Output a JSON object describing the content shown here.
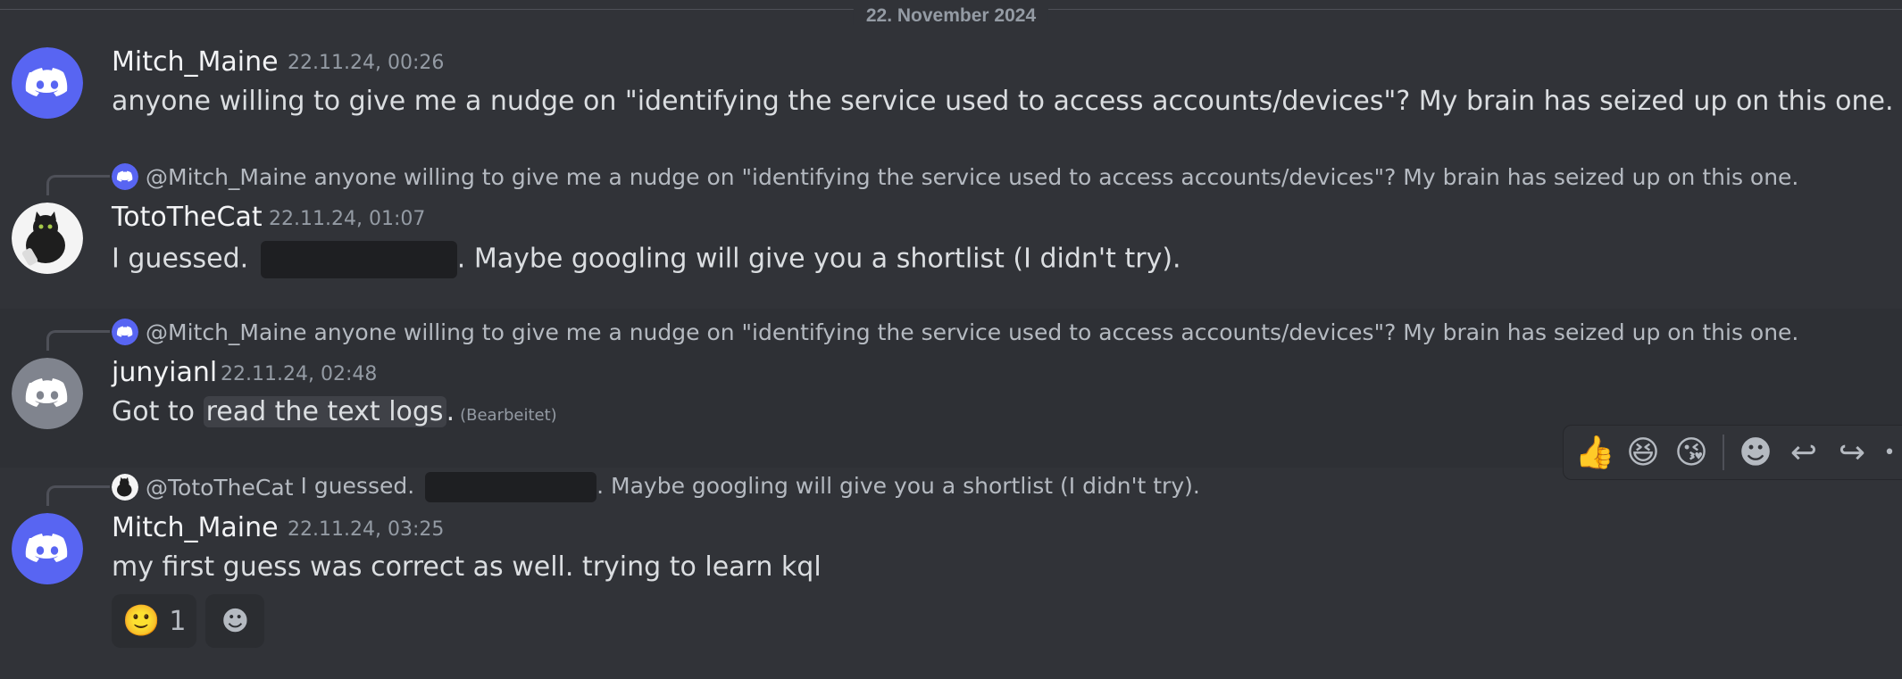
{
  "date_divider": "22. November 2024",
  "messages": [
    {
      "username": "Mitch_Maine",
      "timestamp": "22.11.24, 00:26",
      "text": "anyone willing to give me a nudge on \"identifying the service used to access accounts/devices\"? My brain has seized up on this one."
    },
    {
      "reply_to_name": "@Mitch_Maine",
      "reply_to_text": "anyone willing to give me a nudge on \"identifying the service used to access accounts/devices\"? My brain has seized up on this one.",
      "username": "TotoTheCat",
      "timestamp": "22.11.24, 01:07",
      "text_before": "I guessed.",
      "text_after": ". Maybe googling will give you a shortlist (I didn't try)."
    },
    {
      "reply_to_name": "@Mitch_Maine",
      "reply_to_text": "anyone willing to give me a nudge on \"identifying the service used to access accounts/devices\"? My brain has seized up on this one.",
      "username": "junyianl",
      "timestamp": "22.11.24, 02:48",
      "text_before": "Got to",
      "text_highlight": "read the text logs",
      "text_after": ".",
      "edited": "(Bearbeitet)"
    },
    {
      "reply_to_name": "@TotoTheCat",
      "reply_to_text_before": "I guessed.",
      "reply_to_text_after": ". Maybe googling will give you a shortlist (I didn't try).",
      "username": "Mitch_Maine",
      "timestamp": "22.11.24, 03:25",
      "text": "my first guess was correct as well. trying to learn kql",
      "reactions": [
        {
          "emoji": "🙂",
          "count": "1"
        }
      ],
      "add_reaction_icon": "☻"
    }
  ],
  "toolbar": {
    "emoji_1": "👍",
    "emoji_2": "😆",
    "emoji_3": "😘",
    "add_reaction": "☻",
    "reply": "↩",
    "forward": "↪",
    "more": "•"
  },
  "colors": {
    "background": "#313338",
    "blurple": "#5865f2",
    "grey_avatar": "#80848e"
  }
}
